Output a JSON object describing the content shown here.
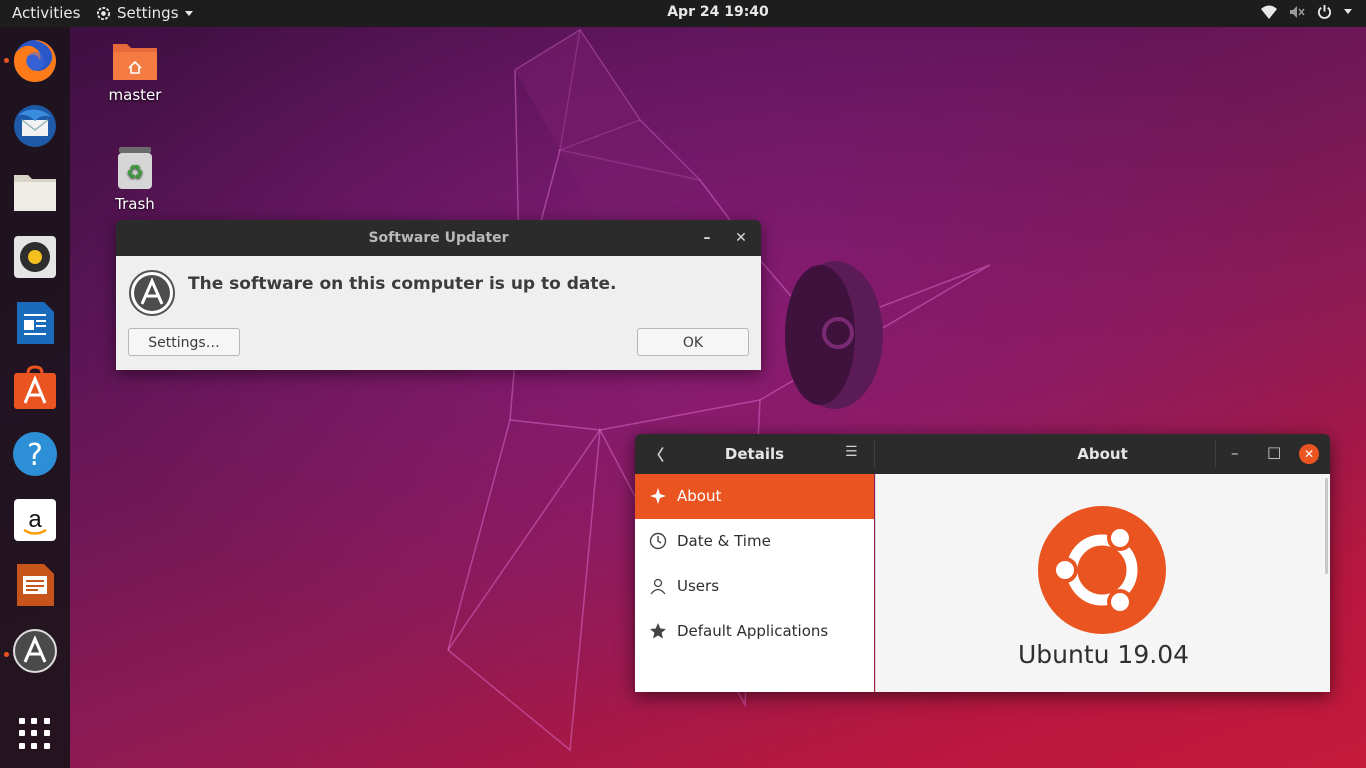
{
  "topbar": {
    "activities": "Activities",
    "app_menu": "Settings",
    "clock": "Apr 24  19:40",
    "tray_icons": [
      "wifi-icon",
      "volume-muted-icon",
      "power-icon"
    ]
  },
  "dock": {
    "items": [
      "firefox-icon",
      "thunderbird-icon",
      "files-icon",
      "rhythmbox-icon",
      "libreoffice-writer-icon",
      "ubuntu-software-icon",
      "help-icon",
      "amazon-icon",
      "libreoffice-impress-icon",
      "software-updater-icon"
    ],
    "running": [
      "firefox-icon",
      "software-updater-icon"
    ]
  },
  "desktop": {
    "home_label": "master",
    "trash_label": "Trash"
  },
  "updater": {
    "title": "Software Updater",
    "message": "The software on this computer is up to date.",
    "settings_button": "Settings…",
    "ok_button": "OK",
    "minimize": "–",
    "close": "✕"
  },
  "settings": {
    "panel_title": "Details",
    "page_title": "About",
    "back": "〈",
    "menu": "☰",
    "minimize": "–",
    "maximize": "□",
    "close": "✕",
    "sidebar": [
      {
        "label": "About",
        "icon": "sparkle-icon",
        "active": true
      },
      {
        "label": "Date & Time",
        "icon": "clock-icon",
        "active": false
      },
      {
        "label": "Users",
        "icon": "user-icon",
        "active": false
      },
      {
        "label": "Default Applications",
        "icon": "star-icon",
        "active": false
      }
    ],
    "os_version": "Ubuntu 19.04",
    "accent": "#e95420"
  }
}
